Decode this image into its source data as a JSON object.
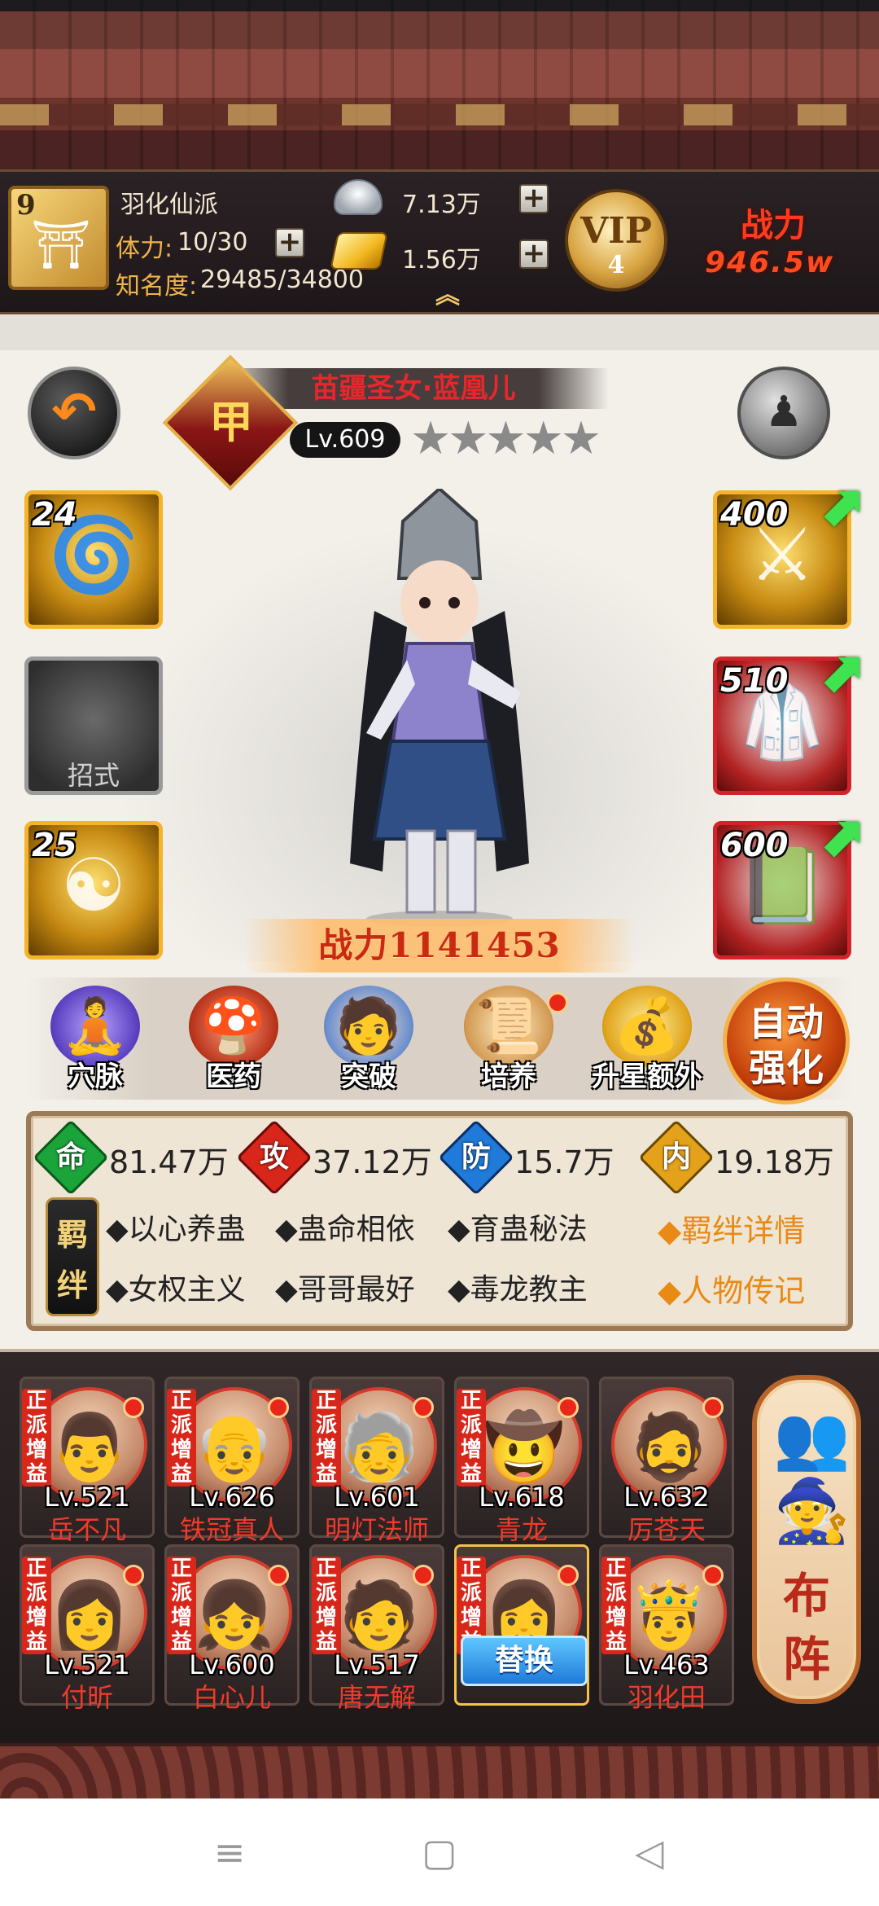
{
  "player": {
    "avatar_level": "9",
    "name": "羽化仙派",
    "stamina_label": "体力:",
    "stamina_value": "10/30",
    "fame_label": "知名度:",
    "fame_value": "29485/34800"
  },
  "currency": {
    "silver": "7.13万",
    "gold": "1.56万"
  },
  "vip": {
    "text": "VIP",
    "level": "4"
  },
  "top_power": {
    "label": "战力",
    "value": "946.5w"
  },
  "hero": {
    "rank_char": "甲",
    "name": "苗疆圣女·蓝凰儿",
    "level": "Lv.609",
    "stars": "★★★★★",
    "power": "战力1141453"
  },
  "slots_left": [
    {
      "num": "24",
      "label": ""
    },
    {
      "num": "",
      "label": "招式"
    },
    {
      "num": "25",
      "label": ""
    }
  ],
  "slots_right": [
    {
      "num": "400"
    },
    {
      "num": "510"
    },
    {
      "num": "600"
    }
  ],
  "functions": [
    {
      "label": "穴脉",
      "icon": "meridian-icon"
    },
    {
      "label": "医药",
      "icon": "medicine-icon"
    },
    {
      "label": "突破",
      "icon": "breakthrough-icon"
    },
    {
      "label": "培养",
      "icon": "cultivate-icon"
    },
    {
      "label": "升星额外",
      "icon": "star-up-icon"
    }
  ],
  "auto_enhance": "自动强化",
  "stats": [
    {
      "gem": "命",
      "value": "81.47万",
      "color": "#1aa43a"
    },
    {
      "gem": "攻",
      "value": "37.12万",
      "color": "#d8261a"
    },
    {
      "gem": "防",
      "value": "15.7万",
      "color": "#1f7ad9"
    },
    {
      "gem": "内",
      "value": "19.18万",
      "color": "#e4a21a"
    }
  ],
  "bonds": {
    "seal": "羁绊",
    "items": [
      "◆以心养蛊",
      "◆蛊命相依",
      "◆育蛊秘法",
      "◆女权主义",
      "◆哥哥最好",
      "◆毒龙教主"
    ],
    "links": [
      "◆羁绊详情",
      "◆人物传记"
    ]
  },
  "team": [
    {
      "level": "Lv.521",
      "name": "岳不凡",
      "tag": "正派增益"
    },
    {
      "level": "Lv.626",
      "name": "铁冠真人",
      "tag": "正派增益"
    },
    {
      "level": "Lv.601",
      "name": "明灯法师",
      "tag": "正派增益"
    },
    {
      "level": "Lv.618",
      "name": "青龙",
      "tag": "正派增益"
    },
    {
      "level": "Lv.632",
      "name": "厉苍天",
      "tag": ""
    },
    {
      "level": "Lv.521",
      "name": "付昕",
      "tag": "正派增益"
    },
    {
      "level": "Lv.600",
      "name": "白心儿",
      "tag": "正派增益"
    },
    {
      "level": "Lv.517",
      "name": "唐无解",
      "tag": "正派增益"
    },
    {
      "level": "",
      "name": "",
      "tag": "正派增益"
    },
    {
      "level": "Lv.463",
      "name": "羽化田",
      "tag": "正派增益"
    }
  ],
  "replace_label": "替换",
  "formation_label": "布阵",
  "nav": {
    "menu": "≡",
    "home": "▢",
    "back": "◁"
  }
}
